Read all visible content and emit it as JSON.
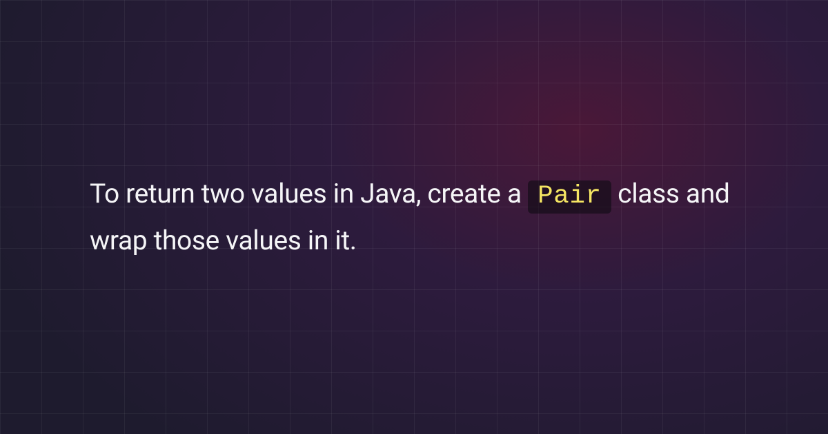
{
  "content": {
    "text_before": "To return two values in Java, create a ",
    "code": "Pair",
    "text_after": " class and wrap those values in it."
  }
}
